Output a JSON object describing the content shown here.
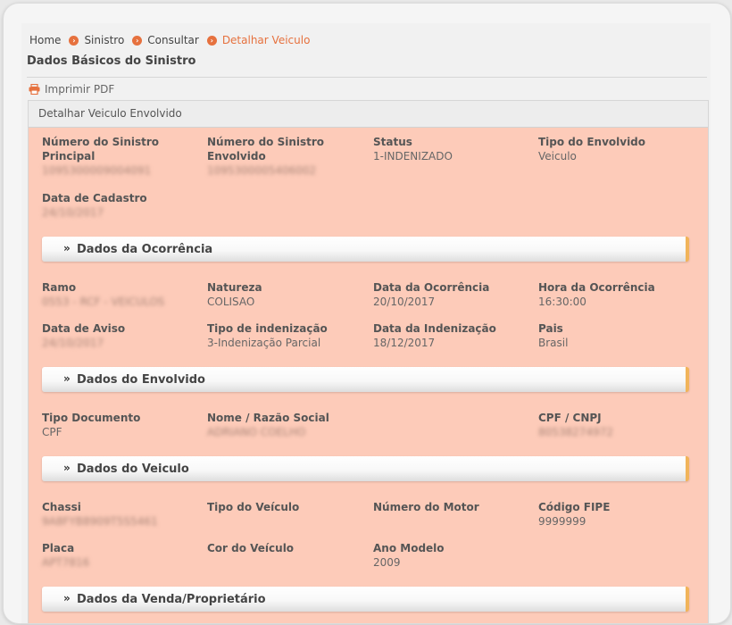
{
  "breadcrumb": [
    "Home",
    "Sinistro",
    "Consultar",
    "Detalhar Veiculo"
  ],
  "page_title": "Dados Básicos do Sinistro",
  "print_label": "Imprimir PDF",
  "panel_title": "Detalhar Veiculo Envolvido",
  "basic": {
    "num_sinistro_principal": {
      "label": "Número do Sinistro Principal",
      "value": "1095300009004091"
    },
    "num_sinistro_envolvido": {
      "label": "Número do Sinistro Envolvido",
      "value": "1095300005406002"
    },
    "status": {
      "label": "Status",
      "value": "1-INDENIZADO"
    },
    "tipo_envolvido": {
      "label": "Tipo do Envolvido",
      "value": "Veiculo"
    },
    "data_cadastro": {
      "label": "Data de Cadastro",
      "value": "24/10/2017"
    }
  },
  "ocorrencia": {
    "title": "Dados da Ocorrência",
    "ramo": {
      "label": "Ramo",
      "value": "0553 - RCF - VEICULOS"
    },
    "natureza": {
      "label": "Natureza",
      "value": "COLISAO"
    },
    "data_ocorrencia": {
      "label": "Data da Ocorrência",
      "value": "20/10/2017"
    },
    "hora_ocorrencia": {
      "label": "Hora da Ocorrência",
      "value": "16:30:00"
    },
    "data_aviso": {
      "label": "Data de Aviso",
      "value": "24/10/2017"
    },
    "tipo_indenizacao": {
      "label": "Tipo de indenização",
      "value": "3-Indenização Parcial"
    },
    "data_indenizacao": {
      "label": "Data da Indenização",
      "value": "18/12/2017"
    },
    "pais": {
      "label": "Pais",
      "value": "Brasil"
    }
  },
  "envolvido": {
    "title": "Dados do Envolvido",
    "tipo_documento": {
      "label": "Tipo Documento",
      "value": "CPF"
    },
    "nome": {
      "label": "Nome / Razão Social",
      "value": "ADRIANO COELHO"
    },
    "cpf_cnpj": {
      "label": "CPF / CNPJ",
      "value": "80538274972"
    }
  },
  "veiculo": {
    "title": "Dados do Veiculo",
    "chassi": {
      "label": "Chassi",
      "value": "9A8FYB8909T5S5461"
    },
    "tipo_veiculo": {
      "label": "Tipo do Veículo",
      "value": ""
    },
    "numero_motor": {
      "label": "Número do Motor",
      "value": ""
    },
    "codigo_fipe": {
      "label": "Código FIPE",
      "value": "9999999"
    },
    "placa": {
      "label": "Placa",
      "value": "APT7816"
    },
    "cor_veiculo": {
      "label": "Cor do Veículo",
      "value": ""
    },
    "ano_modelo": {
      "label": "Ano Modelo",
      "value": "2009"
    }
  },
  "venda": {
    "title": "Dados da Venda/Proprietário"
  },
  "colors": {
    "accent": "#e6713e",
    "panel_bg": "#fdcbb9",
    "section_edge": "#f1b45a"
  }
}
